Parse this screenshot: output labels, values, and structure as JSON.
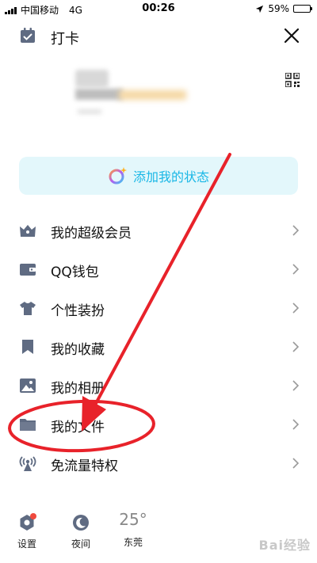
{
  "status_bar": {
    "carrier": "中国移动",
    "network": "4G",
    "time": "00:26",
    "battery": "59%",
    "battery_fraction": 0.59
  },
  "header": {
    "checkin_label": "打卡"
  },
  "status_card": {
    "label": "添加我的状态"
  },
  "menu": [
    {
      "label": "我的超级会员",
      "icon": "crown-icon"
    },
    {
      "label": "QQ钱包",
      "icon": "wallet-icon"
    },
    {
      "label": "个性装扮",
      "icon": "tshirt-icon"
    },
    {
      "label": "我的收藏",
      "icon": "bookmark-icon"
    },
    {
      "label": "我的相册",
      "icon": "photo-icon"
    },
    {
      "label": "我的文件",
      "icon": "folder-icon"
    },
    {
      "label": "免流量特权",
      "icon": "antenna-icon"
    }
  ],
  "bottom_bar": {
    "settings_label": "设置",
    "night_label": "夜间",
    "weather_temp": "25°",
    "weather_city": "东莞"
  },
  "colors": {
    "accent": "#19b7e6",
    "icon_gray": "#5f6b82",
    "annotation_red": "#e8222a",
    "badge_red": "#f04a3e"
  },
  "watermark": "Bai经验"
}
